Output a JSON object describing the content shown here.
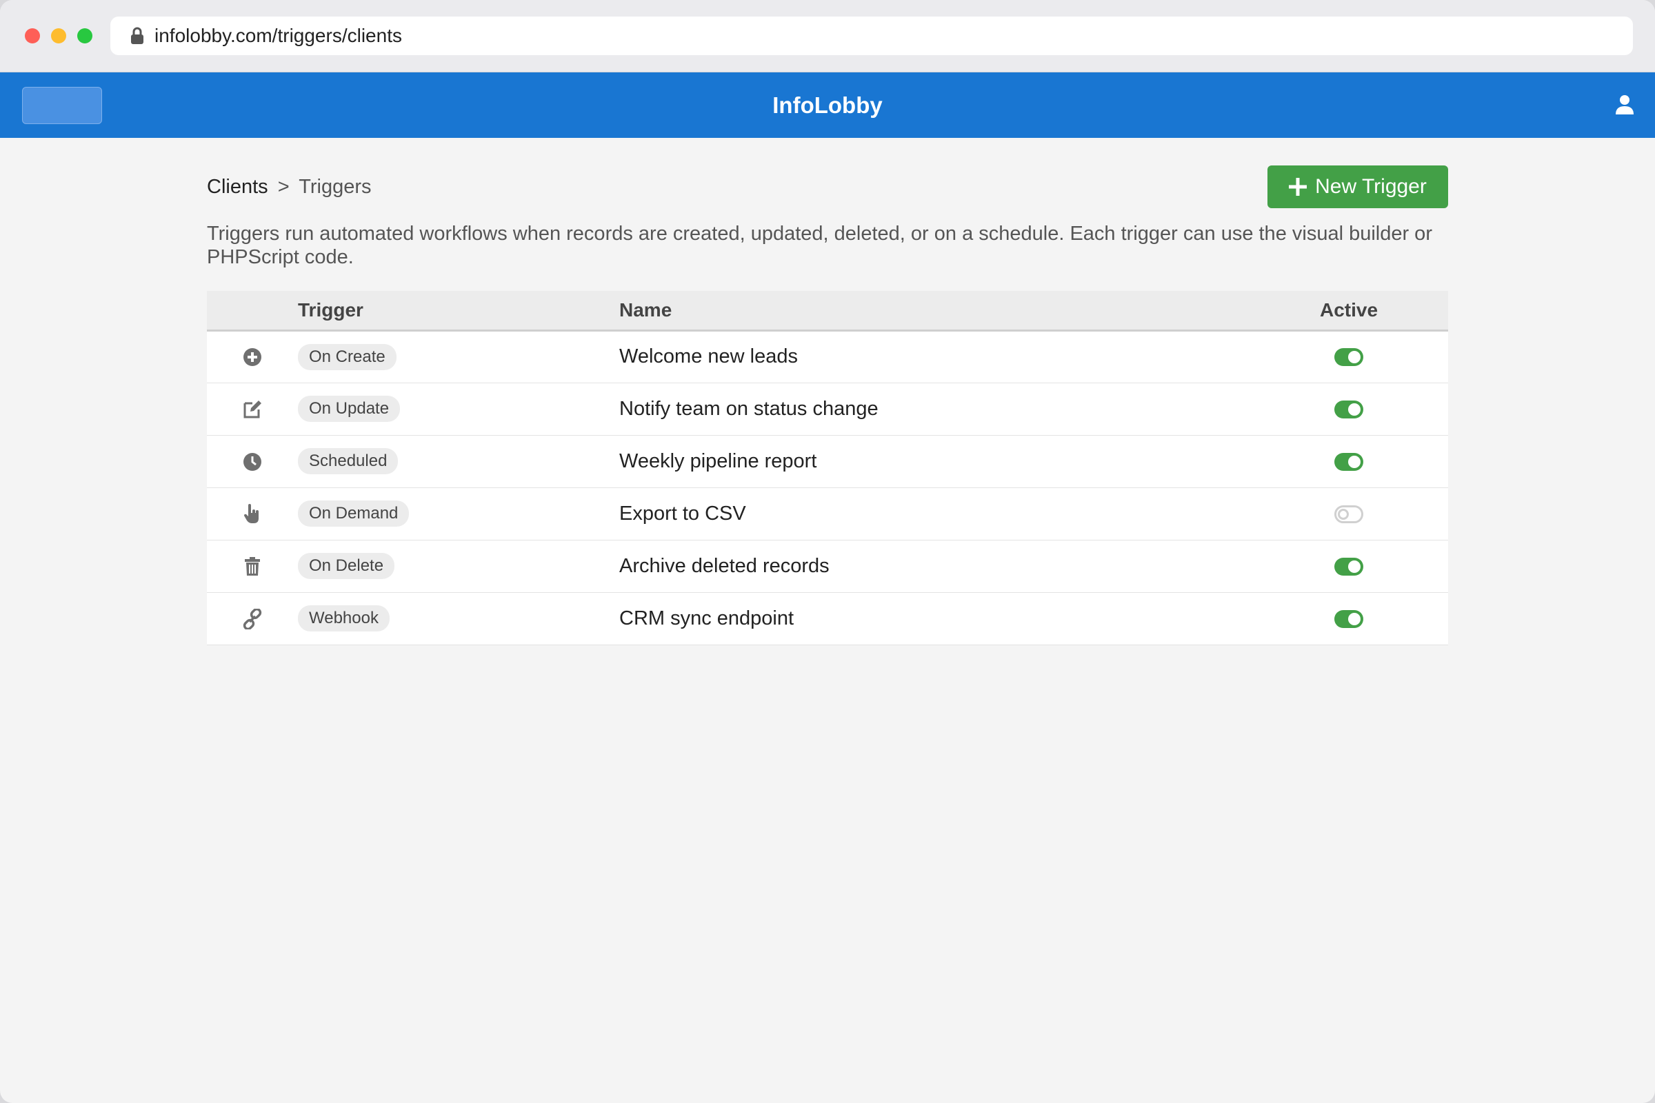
{
  "browser": {
    "url": "infolobby.com/triggers/clients"
  },
  "app": {
    "title": "InfoLobby"
  },
  "breadcrumb": {
    "parent": "Clients",
    "separator": ">",
    "current": "Triggers"
  },
  "actions": {
    "new_trigger_label": "New Trigger"
  },
  "description": "Triggers run automated workflows when records are created, updated, deleted, or on a schedule. Each trigger can use the visual builder or PHPScript code.",
  "table": {
    "headers": {
      "trigger": "Trigger",
      "name": "Name",
      "active": "Active"
    },
    "rows": [
      {
        "icon": "plus-circle-icon",
        "trigger": "On Create",
        "name": "Welcome new leads",
        "active": true
      },
      {
        "icon": "edit-icon",
        "trigger": "On Update",
        "name": "Notify team on status change",
        "active": true
      },
      {
        "icon": "clock-icon",
        "trigger": "Scheduled",
        "name": "Weekly pipeline report",
        "active": true
      },
      {
        "icon": "pointer-hand-icon",
        "trigger": "On Demand",
        "name": "Export to CSV",
        "active": false
      },
      {
        "icon": "trash-icon",
        "trigger": "On Delete",
        "name": "Archive deleted records",
        "active": true
      },
      {
        "icon": "link-icon",
        "trigger": "Webhook",
        "name": "CRM sync endpoint",
        "active": true
      }
    ]
  },
  "colors": {
    "primary": "#1976d2",
    "success": "#43a047",
    "icon_gray": "#6f6f6f"
  }
}
